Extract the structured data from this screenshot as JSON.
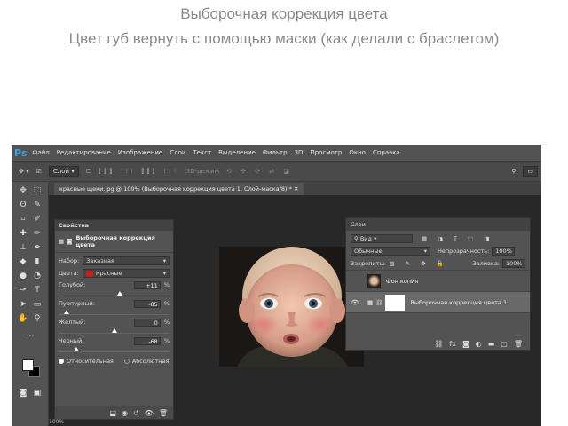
{
  "slide": {
    "title": "Выборочная коррекция цвета",
    "subtitle": "Цвет губ вернуть с помощью маски (как делали с браслетом)"
  },
  "app": {
    "logo": "Ps",
    "menu": [
      "Файл",
      "Редактирование",
      "Изображение",
      "Слои",
      "Текст",
      "Выделение",
      "Фильтр",
      "3D",
      "Просмотр",
      "Окно",
      "Справка"
    ],
    "document_tab": "красные щеки.jpg @ 100% (Выборочная коррекция цвета 1, Слой-маска/8) *"
  },
  "options_bar": {
    "layer_select": "Слой",
    "mode_3d": "3D-режим"
  },
  "properties": {
    "panel_title": "Свойства",
    "adjustment_name": "Выборочная коррекция цвета",
    "preset_label": "Набор:",
    "preset_value": "Заказная",
    "colors_label": "Цвета:",
    "colors_value": "Красные",
    "colors_swatch": "#c8201e",
    "sliders": [
      {
        "label": "Голубой:",
        "value": "+11",
        "unit": "%",
        "fraction": 0.555
      },
      {
        "label": "Пурпурный:",
        "value": "-85",
        "unit": "%",
        "fraction": 0.075
      },
      {
        "label": "Желтый:",
        "value": "0",
        "unit": "%",
        "fraction": 0.5
      },
      {
        "label": "Черный:",
        "value": "-68",
        "unit": "%",
        "fraction": 0.16
      }
    ],
    "method_relative": "Относительная",
    "method_absolute": "Абсолютная"
  },
  "layers": {
    "panel_title": "Слои",
    "search_kind": "Вид",
    "blend_mode": "Обычные",
    "opacity_label": "Непрозрачность:",
    "opacity_value": "100%",
    "lock_label": "Закрепить:",
    "fill_label": "Заливка:",
    "fill_value": "100%",
    "layer_list": [
      {
        "name": "Фон копия"
      },
      {
        "name": "Выборочная коррекция цвета 1"
      }
    ]
  },
  "statusbar": {
    "zoom": "100%"
  }
}
